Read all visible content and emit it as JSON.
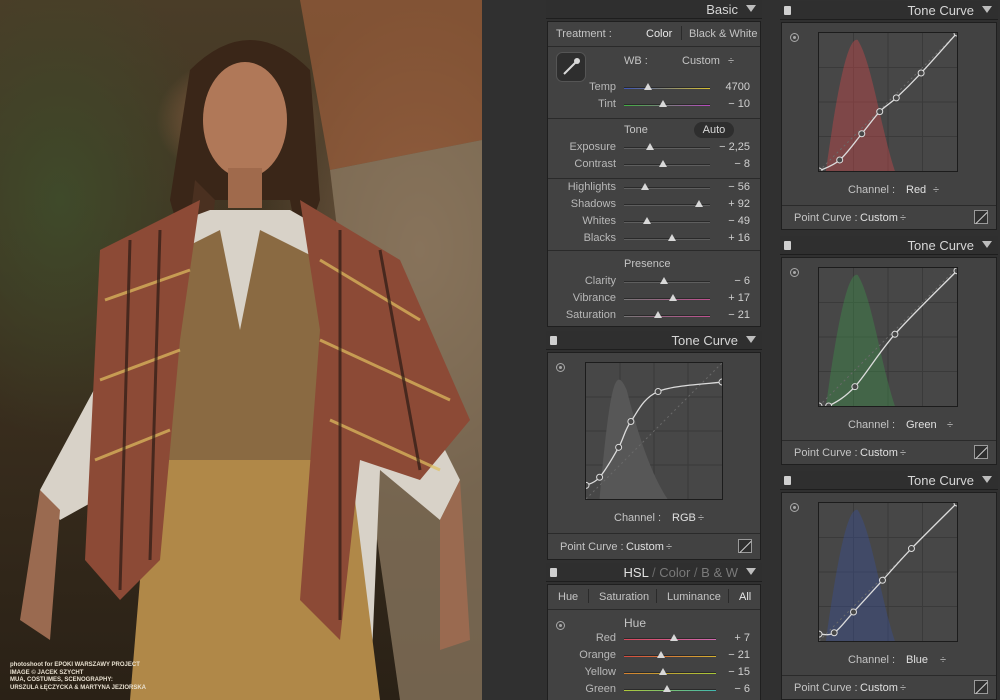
{
  "photo": {
    "credit_lines": [
      "photoshoot for EPOKI WARSZAWY PROJECT",
      "IMAGE © JACEK SZYCHT",
      "MUA, COSTUMES, SCENOGRAPHY:",
      "URSZULA ŁĘCZYCKA & MARTYNA JEZIORSKA"
    ]
  },
  "basic": {
    "title": "Basic",
    "treatment_label": "Treatment :",
    "treatment_color": "Color",
    "treatment_bw": "Black & White",
    "wb_label": "WB :",
    "wb_value": "Custom",
    "wb_arrows": "÷",
    "temp_label": "Temp",
    "temp_value": "4700",
    "temp_pos": 0.28,
    "tint_label": "Tint",
    "tint_value": "− 10",
    "tint_pos": 0.45,
    "tone_label": "Tone",
    "auto_label": "Auto",
    "tone_rows": [
      {
        "label": "Exposure",
        "value": "− 2,25",
        "pos": 0.3
      },
      {
        "label": "Contrast",
        "value": "− 8",
        "pos": 0.45
      },
      {
        "label": "Highlights",
        "value": "− 56",
        "pos": 0.24
      },
      {
        "label": "Shadows",
        "value": "+ 92",
        "pos": 0.87
      },
      {
        "label": "Whites",
        "value": "− 49",
        "pos": 0.27
      },
      {
        "label": "Blacks",
        "value": "+ 16",
        "pos": 0.56
      }
    ],
    "presence_label": "Presence",
    "presence_rows": [
      {
        "label": "Clarity",
        "value": "− 6",
        "pos": 0.46
      },
      {
        "label": "Vibrance",
        "value": "+ 17",
        "pos": 0.57
      },
      {
        "label": "Saturation",
        "value": "− 21",
        "pos": 0.4
      }
    ]
  },
  "tone_curve_main": {
    "title": "Tone Curve",
    "channel_label": "Channel :",
    "channel_value": "RGB",
    "point_curve_label": "Point Curve :",
    "point_curve_value": "Custom",
    "arrows": "÷",
    "points": [
      [
        0,
        0.1
      ],
      [
        0.1,
        0.16
      ],
      [
        0.24,
        0.38
      ],
      [
        0.33,
        0.57
      ],
      [
        0.53,
        0.79
      ],
      [
        1,
        0.86
      ]
    ]
  },
  "hsl": {
    "title_hsl": "HSL",
    "title_color": "Color",
    "title_bw": "B & W",
    "slash": "/",
    "tabs": [
      "Hue",
      "Saturation",
      "Luminance",
      "All"
    ],
    "section_label": "Hue",
    "rows": [
      {
        "label": "Red",
        "value": "+ 7",
        "pos": 0.54,
        "colors": [
          "#d8485b",
          "#d06ab0"
        ]
      },
      {
        "label": "Orange",
        "value": "− 21",
        "pos": 0.4,
        "colors": [
          "#d44a40",
          "#d4b030"
        ]
      },
      {
        "label": "Yellow",
        "value": "− 15",
        "pos": 0.42,
        "colors": [
          "#d48030",
          "#a8c838"
        ]
      },
      {
        "label": "Green",
        "value": "− 6",
        "pos": 0.47,
        "colors": [
          "#b0c838",
          "#40b8b0"
        ]
      }
    ]
  },
  "tone_curves_side": [
    {
      "title": "Tone Curve",
      "channel_label": "Channel :",
      "channel_value": "Red",
      "point_curve_label": "Point Curve :",
      "point_curve_value": "Custom",
      "arrows": "÷",
      "tint": "#c0484a",
      "points": [
        [
          0,
          0
        ],
        [
          0.15,
          0.08
        ],
        [
          0.31,
          0.27
        ],
        [
          0.44,
          0.43
        ],
        [
          0.56,
          0.53
        ],
        [
          0.74,
          0.71
        ],
        [
          1,
          1
        ]
      ]
    },
    {
      "title": "Tone Curve",
      "channel_label": "Channel :",
      "channel_value": "Green",
      "point_curve_label": "Point Curve :",
      "point_curve_value": "Custom",
      "arrows": "÷",
      "tint": "#3e8a4a",
      "points": [
        [
          0,
          0
        ],
        [
          0.07,
          0
        ],
        [
          0.26,
          0.14
        ],
        [
          0.55,
          0.52
        ],
        [
          1,
          0.98
        ]
      ]
    },
    {
      "title": "Tone Curve",
      "channel_label": "Channel :",
      "channel_value": "Blue",
      "point_curve_label": "Point Curve :",
      "point_curve_value": "Custom",
      "arrows": "÷",
      "tint": "#3a4e8e",
      "points": [
        [
          0,
          0.05
        ],
        [
          0.11,
          0.06
        ],
        [
          0.25,
          0.21
        ],
        [
          0.46,
          0.44
        ],
        [
          0.67,
          0.67
        ],
        [
          1,
          1
        ]
      ]
    }
  ],
  "colors": {
    "panel": "#3b3b3b",
    "header": "#2f2f2f",
    "accent_text": "#d6d6d6"
  }
}
